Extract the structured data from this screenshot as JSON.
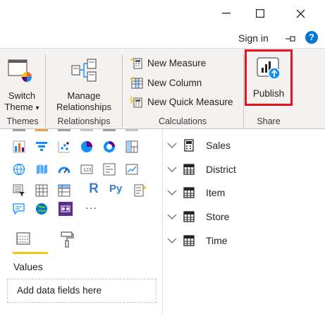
{
  "window": {
    "minimize_glyph": "—",
    "maximize_glyph": "☐",
    "close_glyph": "✕"
  },
  "account": {
    "sign_in": "Sign in",
    "help_glyph": "?"
  },
  "ribbon": {
    "switch_theme": {
      "line1": "Switch",
      "line2": "Theme",
      "dropdown": "▾"
    },
    "manage_relationships": {
      "line1": "Manage",
      "line2": "Relationships"
    },
    "calculations": [
      {
        "label": "New Measure"
      },
      {
        "label": "New Column"
      },
      {
        "label": "New Quick Measure"
      }
    ],
    "publish": {
      "label": "Publish"
    },
    "groups": {
      "themes": "Themes",
      "relationships": "Relationships",
      "calculations": "Calculations",
      "share": "Share"
    },
    "highlight_color": "#e81123"
  },
  "visualizations": {
    "visual_letters": {
      "r": "R",
      "py": "Py",
      "more": "···"
    },
    "values_label": "Values",
    "drop_placeholder": "Add data fields here",
    "accent_color": "#f2c811"
  },
  "fields": {
    "tables": [
      {
        "name": "Sales",
        "icon": "calculator-icon"
      },
      {
        "name": "District",
        "icon": "table-icon"
      },
      {
        "name": "Item",
        "icon": "table-icon"
      },
      {
        "name": "Store",
        "icon": "table-icon"
      },
      {
        "name": "Time",
        "icon": "table-icon"
      }
    ]
  }
}
